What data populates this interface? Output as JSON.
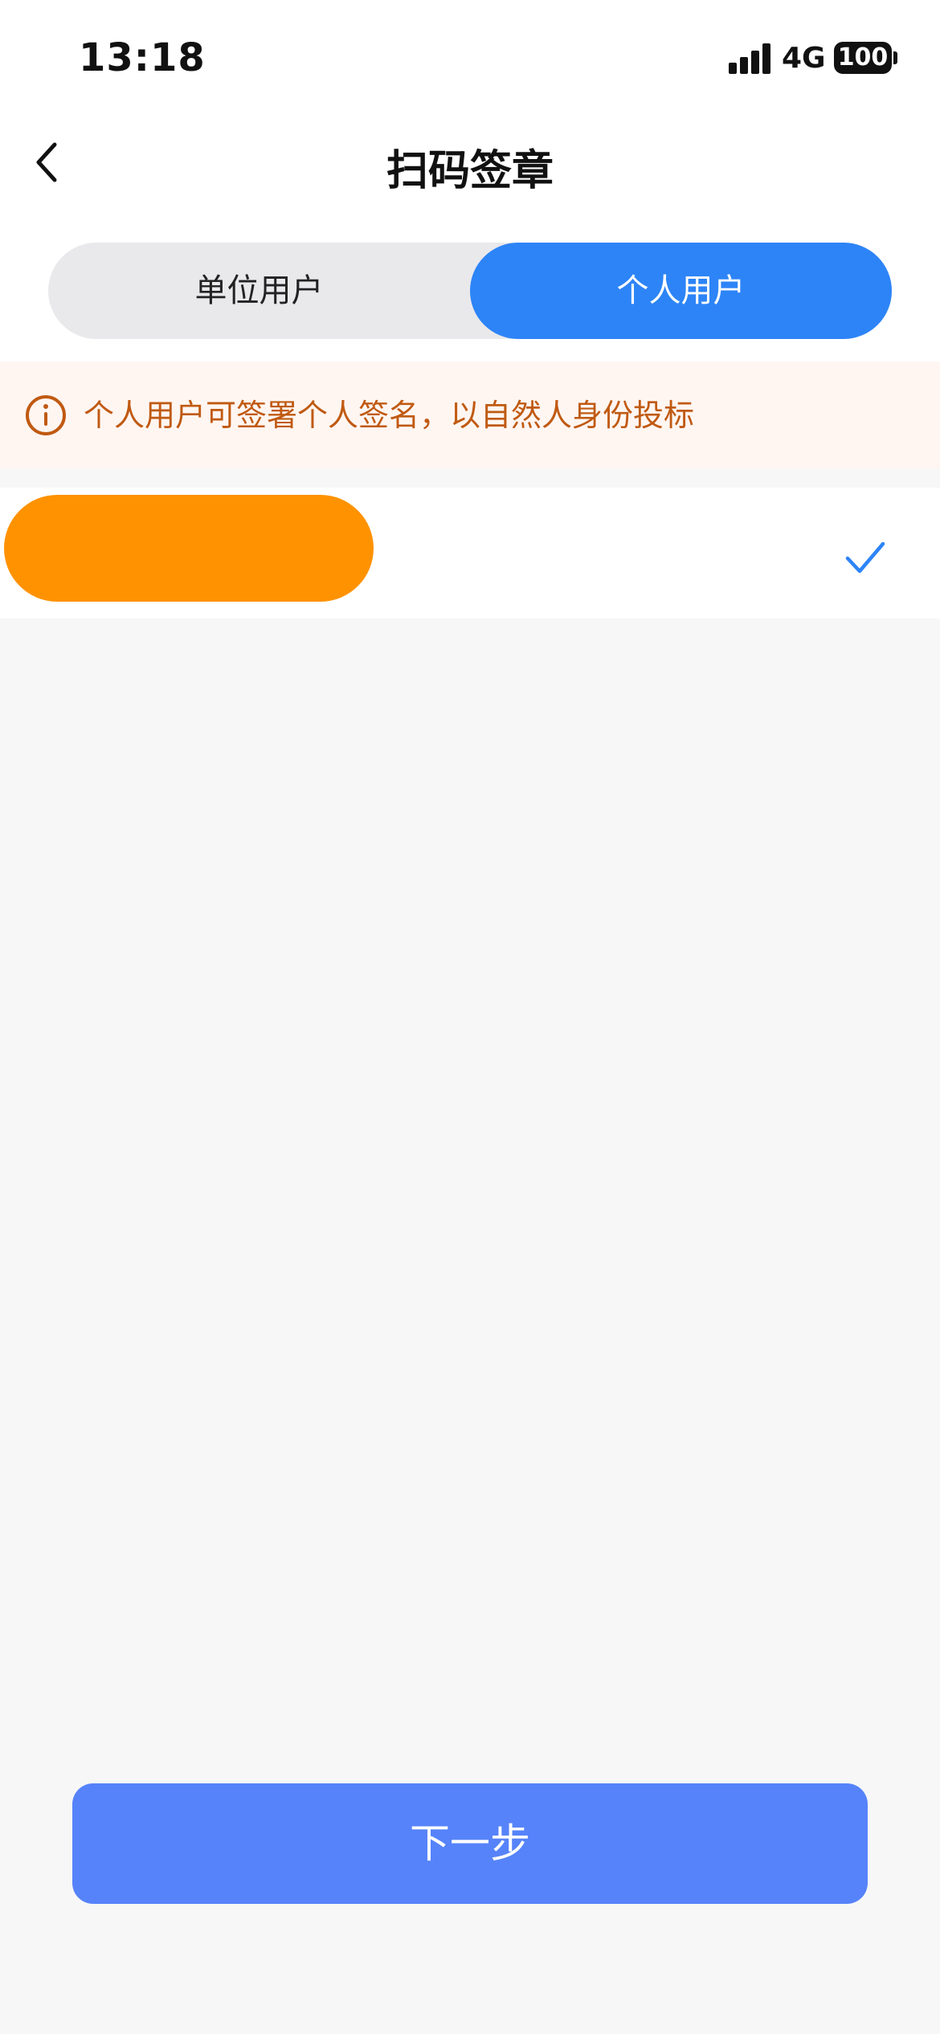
{
  "status_bar": {
    "time": "13:18",
    "network": "4G",
    "battery": "100"
  },
  "nav": {
    "title": "扫码签章",
    "back_icon": "chevron-left-icon"
  },
  "segment": {
    "tabs": [
      {
        "label": "单位用户",
        "selected": false
      },
      {
        "label": "个人用户",
        "selected": true
      }
    ]
  },
  "notice": {
    "icon": "info-icon",
    "text": "个人用户可签署个人签名，以自然人身份投标"
  },
  "user_list": {
    "items": [
      {
        "name": "",
        "selected": true,
        "check_icon": "checkmark-icon"
      }
    ]
  },
  "actions": {
    "next_label": "下一步"
  },
  "colors": {
    "primary": "#2d84f7",
    "button": "#5683fa",
    "notice_text": "#c05a12",
    "notice_bg": "#fff6f2",
    "redaction": "#ff9200"
  }
}
